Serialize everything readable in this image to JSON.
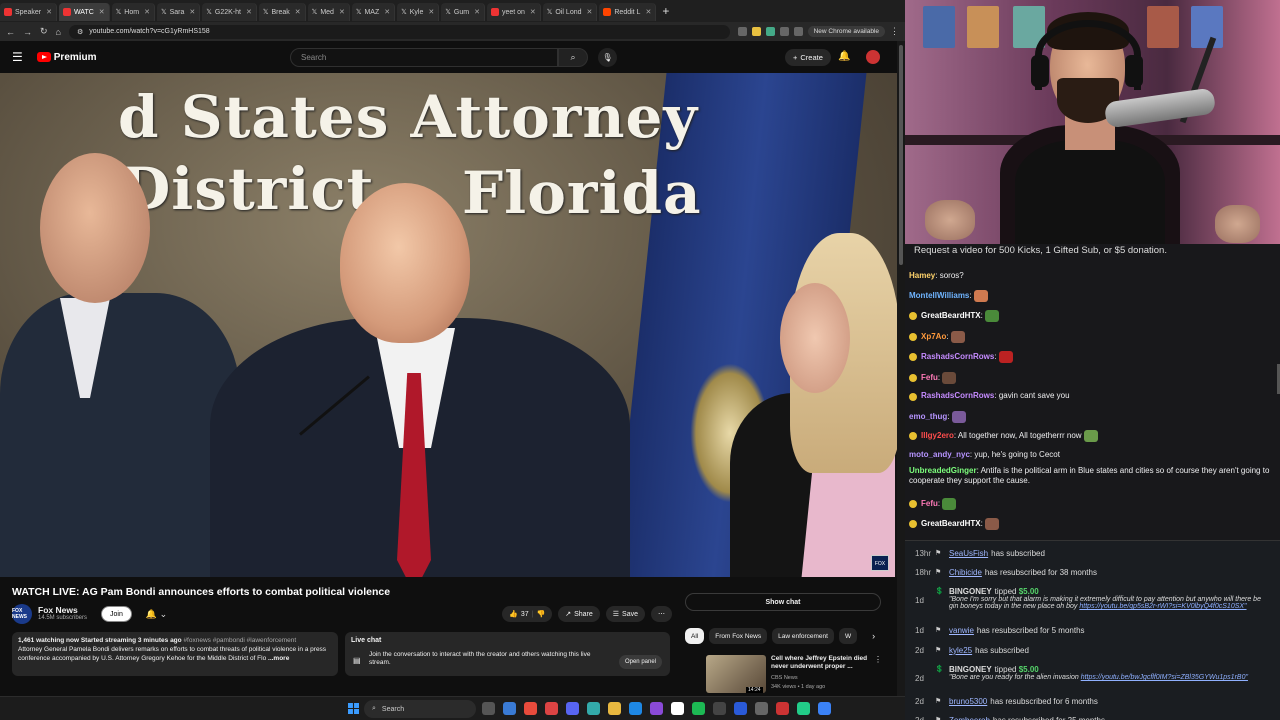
{
  "browser": {
    "tabs": [
      {
        "label": "Speaker",
        "icon": "youtube-favicon"
      },
      {
        "label": "WATC",
        "icon": "youtube-favicon",
        "active": true
      },
      {
        "label": "Hom",
        "icon": "x-favicon"
      },
      {
        "label": "Sara",
        "icon": "x-favicon"
      },
      {
        "label": "G22K-ht",
        "icon": "x-favicon"
      },
      {
        "label": "Break",
        "icon": "x-favicon"
      },
      {
        "label": "Med",
        "icon": "x-favicon"
      },
      {
        "label": "MAZ",
        "icon": "x-favicon"
      },
      {
        "label": "Kyle",
        "icon": "x-favicon"
      },
      {
        "label": "Gum",
        "icon": "x-favicon"
      },
      {
        "label": "yeet on",
        "icon": "youtube-favicon"
      },
      {
        "label": "Oil Lond",
        "icon": "x-favicon"
      },
      {
        "label": "Reddit L",
        "icon": "reddit-favicon"
      }
    ],
    "url": "youtube.com/watch?v=cG1yRmHS158",
    "new_chrome_label": "New Chrome available"
  },
  "youtube": {
    "logo_text": "Premium",
    "search_placeholder": "Search",
    "create_label": "Create"
  },
  "video": {
    "sign_line1": "d States Attorney",
    "sign_line2": "District",
    "sign_line3": "Florida",
    "title": "WATCH LIVE: AG Pam Bondi announces efforts to combat political violence",
    "channel_name": "Fox News",
    "channel_subs": "14.5M subscribers",
    "channel_avatar_text": "FOX NEWS",
    "join_label": "Join",
    "likes": "37",
    "share_label": "Share",
    "save_label": "Save",
    "desc_meta": "1,461 watching now  Started streaming 3 minutes ago",
    "desc_tags": "#foxnews #pambondi #lawenforcement",
    "desc_text": "Attorney General Pamela Bondi delivers remarks on efforts to combat threats of political violence in a press conference accompanied by U.S. Attorney Gregory Kehoe for the Middle District of Flo",
    "desc_more": "...more",
    "live_chat_title": "Live chat",
    "live_chat_desc": "Join the conversation to interact with the creator and others watching this live stream.",
    "open_panel_label": "Open panel"
  },
  "sidebar": {
    "show_chat_label": "Show chat",
    "chips": [
      "All",
      "From Fox News",
      "Law enforcement",
      "W"
    ],
    "rec": {
      "title": "Cell where Jeffrey Epstein died never underwent proper ...",
      "channel": "CBS News",
      "meta": "34K views • 1 day ago",
      "duration": "14:24"
    }
  },
  "taskbar": {
    "search_label": "Search"
  },
  "chat": {
    "pinned": "Request a video for 500 Kicks, 1 Gifted Sub, or $5 donation.",
    "messages": [
      {
        "user": "Hamey",
        "text": "soros?",
        "color": "#ffd36b"
      },
      {
        "user": "MontellWilliams",
        "text": "",
        "color": "#6fb4ff"
      },
      {
        "user": "GreatBeardHTX",
        "text": "",
        "color": "#ffffff"
      },
      {
        "user": "Xp7Ao",
        "text": "",
        "color": "#ff9a3c"
      },
      {
        "user": "RashadsCornRows",
        "text": "",
        "color": "#c58bff"
      },
      {
        "user": "Fefu",
        "text": "",
        "color": "#ff7ab8"
      },
      {
        "user": "RashadsCornRows",
        "text": "gavin cant save you",
        "color": "#c58bff"
      },
      {
        "user": "emo_thug",
        "text": "",
        "color": "#b694ff"
      },
      {
        "user": "Illgy2ero",
        "text": "All together now, All togetherrr now",
        "color": "#ff4d4d"
      },
      {
        "user": "moto_andy_nyc",
        "text": "yup, he's going to Cecot",
        "color": "#b694ff"
      },
      {
        "user": "UnbreadedGinger",
        "text": "Antifa is the political arm in Blue states and cities so of course they aren't going to cooperate they support the cause.",
        "color": "#7dff7d"
      },
      {
        "user": "Fefu",
        "text": "",
        "color": "#ff7ab8"
      },
      {
        "user": "GreatBeardHTX",
        "text": "",
        "color": "#ffffff"
      }
    ]
  },
  "feed": {
    "rows": [
      {
        "time": "13hr",
        "name": "SeaUsFish",
        "text": "has subscribed"
      },
      {
        "time": "18hr",
        "name": "Chibicide",
        "text": "has resubscribed for 38 months"
      },
      {
        "time": "1d",
        "name": "BINGONEY",
        "amount": "$5.00",
        "verb": "tipped",
        "msg": "\"Bone I'm sorry but that alarm is making it extremely difficult to pay attention but anywho will there be gin boneys today in the new place oh boy",
        "link": "https://youtu.be/qp5sB2r-rWI?si=KV0lbyQ4f0cS10SX\""
      },
      {
        "time": "1d",
        "name": "vanwie",
        "text": "has resubscribed for 5 months"
      },
      {
        "time": "2d",
        "name": "kyle25",
        "text": "has subscribed"
      },
      {
        "time": "2d",
        "name": "BINGONEY",
        "amount": "$5.00",
        "verb": "tipped",
        "msg": "\"Bone are you ready for the alien invasion",
        "link": "https://youtu.be/bwJgcflf0IM?si=ZBl35GYWu1ps1rB0\""
      },
      {
        "time": "2d",
        "name": "bruno5300",
        "text": "has resubscribed for 6 months"
      },
      {
        "time": "2d",
        "name": "Zombeerob",
        "text": "has resubscribed for 25 months"
      }
    ]
  }
}
